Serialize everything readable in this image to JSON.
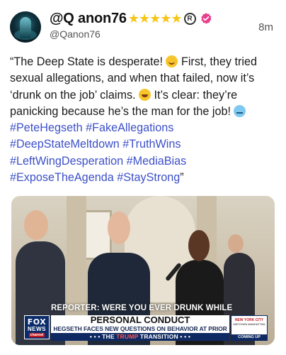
{
  "post": {
    "author": {
      "display_name": "@Q anon76",
      "handle": "@Qanon76",
      "badges": [
        "star-icon",
        "star-icon",
        "star-icon",
        "star-icon",
        "star-icon",
        "registered-icon",
        "verified-badge-icon"
      ]
    },
    "timestamp": "8m",
    "text_segments": [
      "“The Deep State is desperate! ",
      " First, they tried sexual allegations, and when that failed, now it’s ‘drunk on the job’ claims. ",
      " It’s clear: they’re panicking because he’s the man for the job! "
    ],
    "hashtags": [
      "#PeteHegseth",
      "#FakeAllegations",
      "#DeepStateMeltdown",
      "#TruthWins",
      "#LeftWingDesperation",
      "#MediaBias",
      "#ExposeTheAgenda",
      "#StayStrong"
    ],
    "closing_quote": "”",
    "emojis": [
      "winking-face-tongue-emoji",
      "grinning-sweat-emoji",
      "cold-face-emoji"
    ]
  },
  "media": {
    "type": "video-still",
    "caption_top": "REPORTER: WERE YOU EVER DRUNK WHILE",
    "network_logo": {
      "line1": "FOX",
      "line2": "NEWS",
      "line3": "channel"
    },
    "headline": "PERSONAL CONDUCT",
    "subheadline": "HEGSETH FACES NEW QUESTIONS ON BEHAVIOR AT PRIOR JOBS",
    "ticker_prefix": "• • • THE ",
    "ticker_highlight": "TRUMP",
    "ticker_suffix": " TRANSITION • • •",
    "side_box": {
      "line1": "NEW YORK CITY",
      "line2": "MIDTOWN MANHATTAN",
      "line3": "COMING UP"
    }
  },
  "colors": {
    "hashtag": "#3d50c8",
    "star": "#f5c518",
    "verified": "#e83e8c",
    "fox_blue": "#0b2c6b"
  }
}
